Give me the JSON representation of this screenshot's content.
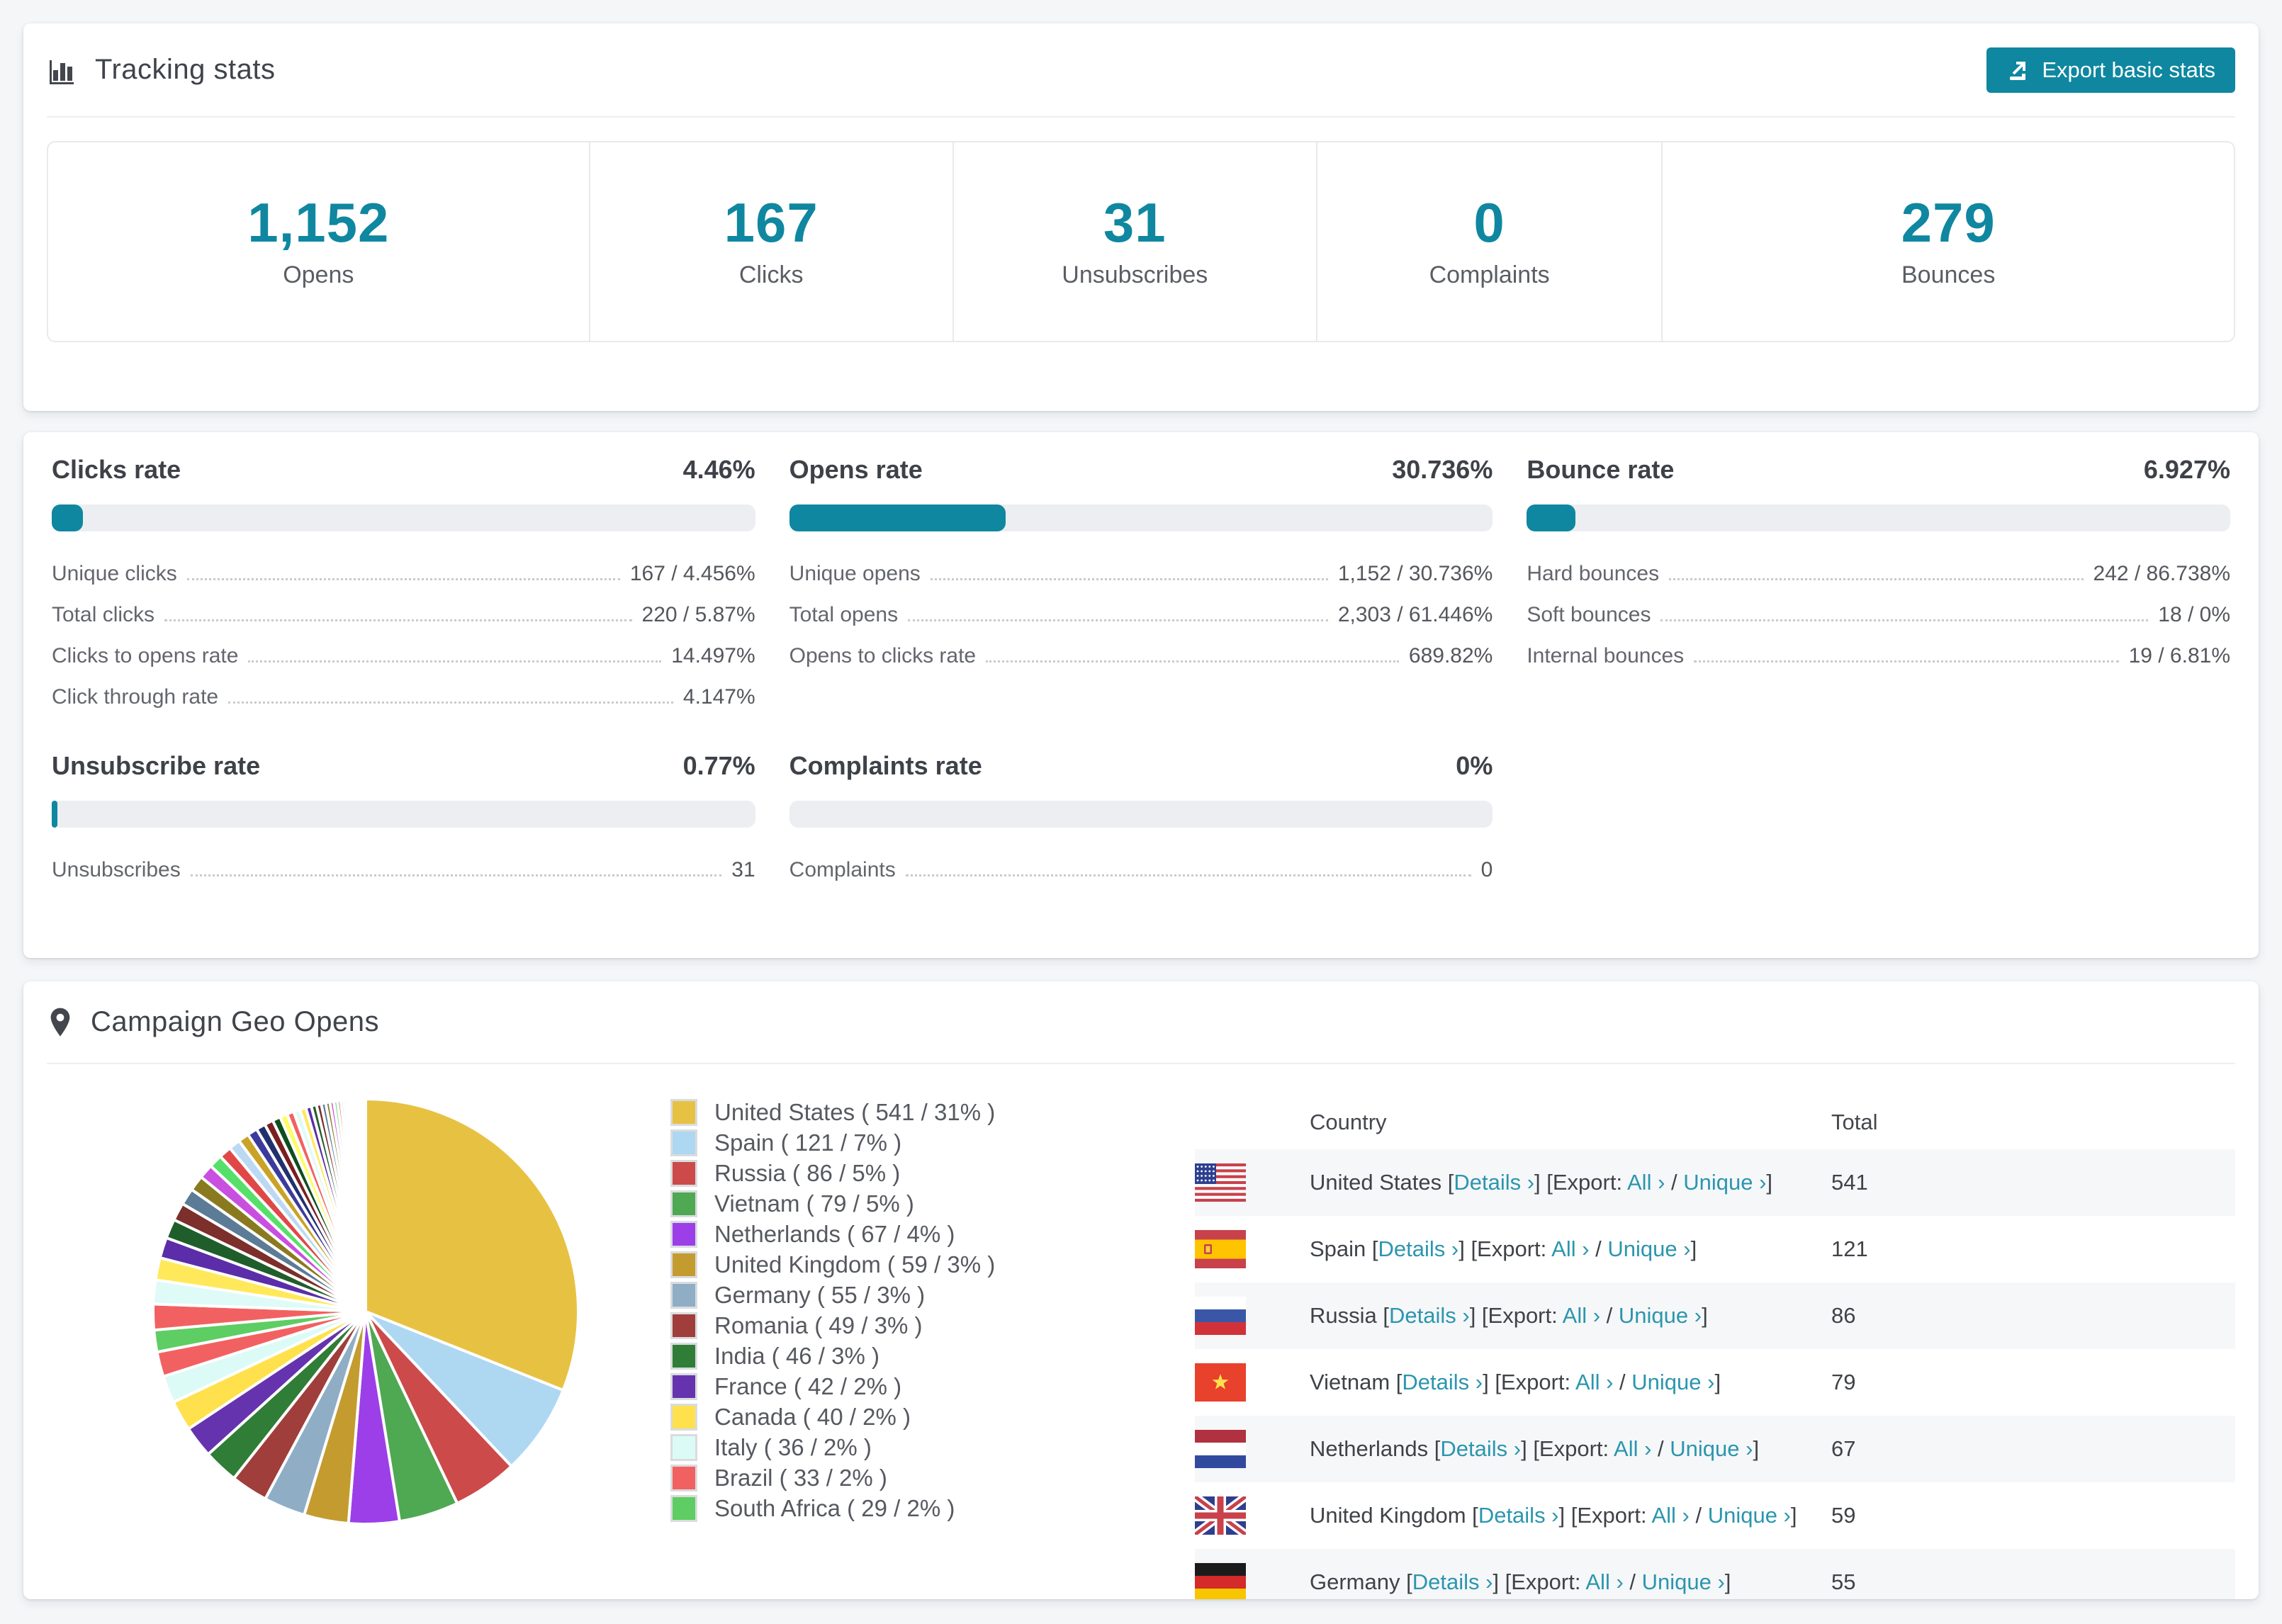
{
  "colors": {
    "accent_teal": "#0F87A0",
    "link_teal": "#2B96AE",
    "bar_track": "#ECEEF1",
    "page_background": "#F4F6F8",
    "card_background": "#FFFFFF",
    "row_alt_background": "#F6F7F9",
    "heading_text": "#3F434A",
    "label_text": "#63666C",
    "value_text": "#54575C"
  },
  "tracking": {
    "title": "Tracking stats",
    "export_button": "Export basic stats",
    "stats": [
      {
        "value": "1,152",
        "label": "Opens"
      },
      {
        "value": "167",
        "label": "Clicks"
      },
      {
        "value": "31",
        "label": "Unsubscribes"
      },
      {
        "value": "0",
        "label": "Complaints"
      },
      {
        "value": "279",
        "label": "Bounces"
      }
    ]
  },
  "rates": {
    "blocks": [
      {
        "id": "clicks",
        "title": "Clicks rate",
        "value": "4.46%",
        "bar_pct": 4.46,
        "rows": [
          {
            "label": "Unique clicks",
            "value": "167 / 4.456%"
          },
          {
            "label": "Total clicks",
            "value": "220 / 5.87%"
          },
          {
            "label": "Clicks to opens rate",
            "value": "14.497%"
          },
          {
            "label": "Click through rate",
            "value": "4.147%"
          }
        ]
      },
      {
        "id": "opens",
        "title": "Opens rate",
        "value": "30.736%",
        "bar_pct": 30.736,
        "rows": [
          {
            "label": "Unique opens",
            "value": "1,152 / 30.736%"
          },
          {
            "label": "Total opens",
            "value": "2,303 / 61.446%"
          },
          {
            "label": "Opens to clicks rate",
            "value": "689.82%"
          }
        ]
      },
      {
        "id": "bounce",
        "title": "Bounce rate",
        "value": "6.927%",
        "bar_pct": 6.927,
        "rows": [
          {
            "label": "Hard bounces",
            "value": "242 / 86.738%"
          },
          {
            "label": "Soft bounces",
            "value": "18 / 0%"
          },
          {
            "label": "Internal bounces",
            "value": "19 / 6.81%"
          }
        ]
      },
      {
        "id": "unsubscribe",
        "title": "Unsubscribe rate",
        "value": "0.77%",
        "bar_pct": 0.77,
        "rows": [
          {
            "label": "Unsubscribes",
            "value": "31"
          }
        ]
      },
      {
        "id": "complaints",
        "title": "Complaints rate",
        "value": "0%",
        "bar_pct": 0,
        "rows": [
          {
            "label": "Complaints",
            "value": "0"
          }
        ]
      }
    ]
  },
  "geo": {
    "title": "Campaign Geo Opens",
    "legend": [
      {
        "label": "United States ( 541 / 31% )",
        "color": "#E7C242"
      },
      {
        "label": "Spain ( 121 / 7% )",
        "color": "#AED7F2"
      },
      {
        "label": "Russia ( 86 / 5% )",
        "color": "#CC4A4A"
      },
      {
        "label": "Vietnam ( 79 / 5% )",
        "color": "#4FA852"
      },
      {
        "label": "Netherlands ( 67 / 4% )",
        "color": "#9C3FE8"
      },
      {
        "label": "United Kingdom ( 59 / 3% )",
        "color": "#C49B2F"
      },
      {
        "label": "Germany ( 55 / 3% )",
        "color": "#8FAEC6"
      },
      {
        "label": "Romania ( 49 / 3% )",
        "color": "#A03E3C"
      },
      {
        "label": "India ( 46 / 3% )",
        "color": "#2F7D36"
      },
      {
        "label": "France ( 42 / 2% )",
        "color": "#6633AE"
      },
      {
        "label": "Canada ( 40 / 2% )",
        "color": "#FFE14D"
      },
      {
        "label": "Italy ( 36 / 2% )",
        "color": "#DCFBF7"
      },
      {
        "label": "Brazil ( 33 / 2% )",
        "color": "#F26161"
      },
      {
        "label": "South Africa ( 29 / 2% )",
        "color": "#5ECD63"
      }
    ],
    "chart_data": {
      "type": "pie",
      "title": "Campaign Geo Opens",
      "legend_position": "right",
      "start_angle_deg": 0,
      "direction": "clockwise",
      "categories": [
        "United States",
        "Spain",
        "Russia",
        "Vietnam",
        "Netherlands",
        "United Kingdom",
        "Germany",
        "Romania",
        "India",
        "France",
        "Canada",
        "Italy",
        "Brazil",
        "South Africa"
      ],
      "values": [
        541,
        121,
        86,
        79,
        67,
        59,
        55,
        49,
        46,
        42,
        40,
        36,
        33,
        29
      ],
      "percent_labels": [
        "31%",
        "7%",
        "5%",
        "5%",
        "4%",
        "3%",
        "3%",
        "3%",
        "3%",
        "2%",
        "2%",
        "2%",
        "2%",
        "2%"
      ],
      "colors": [
        "#E7C242",
        "#AED7F2",
        "#CC4A4A",
        "#4FA852",
        "#9C3FE8",
        "#C49B2F",
        "#8FAEC6",
        "#A03E3C",
        "#2F7D36",
        "#6633AE",
        "#FFE14D",
        "#DCFBF7",
        "#F26161",
        "#5ECD63"
      ],
      "others": {
        "value": 460,
        "label": "Other countries (long tail of small unlabeled slices)",
        "slice_count": 40,
        "decay": 0.93,
        "palette_vivid": [
          "#F26161",
          "#DFFBF7",
          "#FFE95A",
          "#5B2DA8",
          "#1F5E2A",
          "#7C2F2B",
          "#5C7B96",
          "#8A7A1F",
          "#C94FE0",
          "#56E06A",
          "#E04848",
          "#BBD9F2",
          "#C9A227",
          "#3B3B9E",
          "#22306E",
          "#7A1F1F",
          "#0E4D1E",
          "#FDFD66"
        ],
        "palette_pale": [
          "#EDE6F6",
          "#DDF2F8",
          "#F6BFD8",
          "#CFF3E4",
          "#F3F3F3",
          "#E9D9F2"
        ]
      }
    },
    "table": {
      "country_header": "Country",
      "total_header": "Total",
      "links": {
        "details": "Details ›",
        "export": "Export:",
        "all": "All ›",
        "unique": "Unique ›"
      },
      "rows": [
        {
          "country": "United States",
          "flag": "us",
          "total": "541"
        },
        {
          "country": "Spain",
          "flag": "es",
          "total": "121"
        },
        {
          "country": "Russia",
          "flag": "ru",
          "total": "86"
        },
        {
          "country": "Vietnam",
          "flag": "vn",
          "total": "79"
        },
        {
          "country": "Netherlands",
          "flag": "nl",
          "total": "67"
        },
        {
          "country": "United Kingdom",
          "flag": "gb",
          "total": "59"
        },
        {
          "country": "Germany",
          "flag": "de",
          "total": "55"
        }
      ]
    }
  }
}
